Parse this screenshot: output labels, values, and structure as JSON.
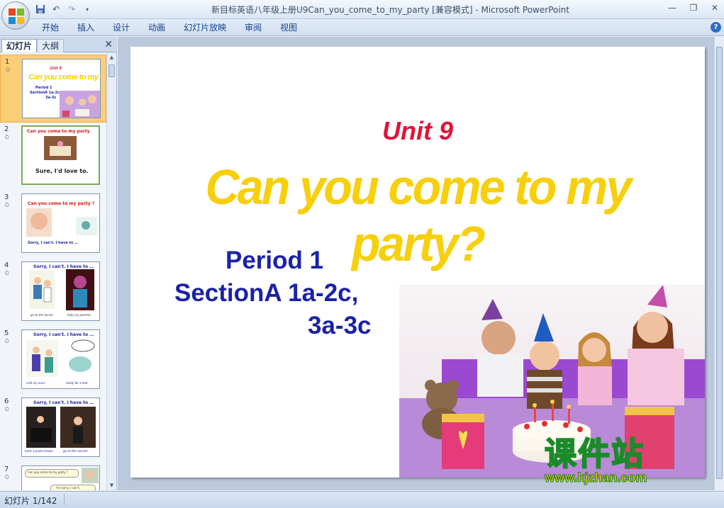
{
  "window": {
    "title": "新目标英语八年级上册U9Can_you_come_to_my_party [兼容模式] - Microsoft PowerPoint"
  },
  "ribbon": {
    "tabs": [
      "开始",
      "插入",
      "设计",
      "动画",
      "幻灯片放映",
      "审阅",
      "视图"
    ]
  },
  "left_panel": {
    "tab_slides": "幻灯片",
    "tab_outline": "大纲",
    "close": "✕",
    "thumbnails": [
      {
        "num": "1",
        "title": "Can you come to my  party?",
        "line1": "Unit 9",
        "line2": "Period 1",
        "line3": "SectionA 1a-2c,",
        "line4": "3a-3c",
        "selected": true
      },
      {
        "num": "2",
        "title": "Can you come to my party",
        "caption": "Sure, I'd love to."
      },
      {
        "num": "3",
        "title": "Can you come to my party ?",
        "caption": "Sorry, I can't. I have to …"
      },
      {
        "num": "4",
        "title": "Sorry, I can't.  I have to …",
        "cap_left": "go to the doctor",
        "cap_right": "help my parents"
      },
      {
        "num": "5",
        "title": "Sorry, I can't.  I have to …",
        "cap_left": "visit my aunt",
        "cap_right": "study for a test"
      },
      {
        "num": "6",
        "title": "Sorry, I can't.  I have to …",
        "cap_left": "have a piano lesson",
        "cap_right": "go to the concert"
      },
      {
        "num": "7",
        "title": "Can you come to my party ?",
        "caption": "I'm sorry, I can't."
      }
    ]
  },
  "slide": {
    "unit": "Unit 9",
    "title": "Can you come to my  party?",
    "period": "Period 1",
    "section_line1": "SectionA 1a-2c,",
    "section_line2": "3a-3c",
    "watermark_cn": "课件站",
    "watermark_url": "www.kjzhan.com"
  },
  "status": {
    "slide_counter": "幻灯片 1/142"
  },
  "colors": {
    "unit_red": "#e0143a",
    "title_yellow": "#f7cf0b",
    "period_blue": "#1a22a8",
    "selected_thumb": "#fbce78"
  }
}
